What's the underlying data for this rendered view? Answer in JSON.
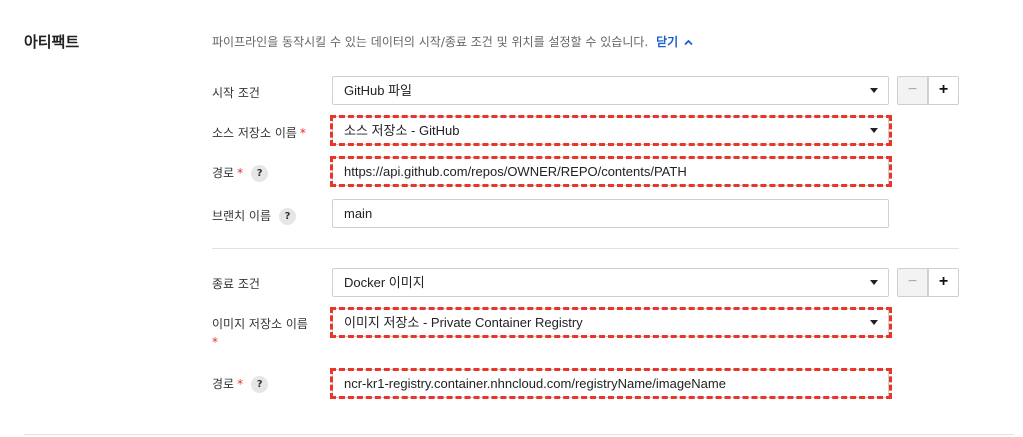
{
  "section": {
    "title": "아티팩트",
    "description": "파이프라인을 동작시킬 수 있는 데이터의 시작/종료 조건 및 위치를 설정할 수 있습니다.",
    "close_label": "닫기",
    "close_icon": "chevron-up-icon"
  },
  "start": {
    "condition_label": "시작 조건",
    "condition_value": "GitHub 파일",
    "repo_label": "소스 저장소 이름",
    "repo_value": "소스 저장소 - GitHub",
    "path_label": "경로",
    "path_value": "https://api.github.com/repos/OWNER/REPO/contents/PATH",
    "branch_label": "브랜치 이름",
    "branch_value": "main"
  },
  "end": {
    "condition_label": "종료 조건",
    "condition_value": "Docker 이미지",
    "repo_label": "이미지 저장소 이름",
    "repo_value": "이미지 저장소 - Private Container Registry",
    "path_label": "경로",
    "path_value": "ncr-kr1-registry.container.nhncloud.com/registryName/imageName"
  },
  "common": {
    "required_mark": "*",
    "help_mark": "?",
    "minus_label": "−",
    "plus_label": "+"
  },
  "colors": {
    "highlight": "#e8372a",
    "link": "#1a5fd1",
    "required": "#e0302a"
  }
}
